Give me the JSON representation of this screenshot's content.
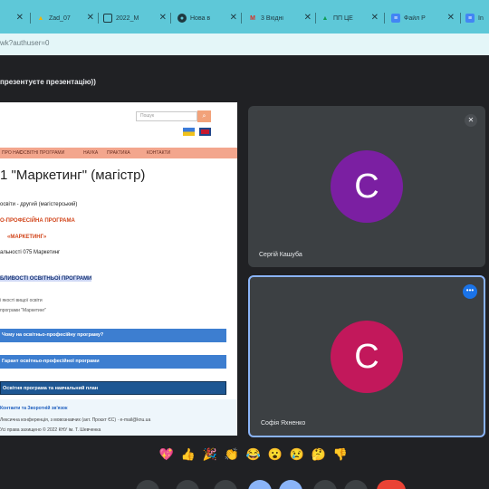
{
  "browser": {
    "tabs": [
      {
        "label": "",
        "icon": "tab-icon"
      },
      {
        "label": "Zad_07",
        "icon": "google-drive-icon"
      },
      {
        "label": "2022_M",
        "icon": "document-icon"
      },
      {
        "label": "Нова в",
        "icon": "globe-icon"
      },
      {
        "label": "3 Вхідні",
        "icon": "gmail-icon"
      },
      {
        "label": "ПП ЦЕ",
        "icon": "google-drive-icon"
      },
      {
        "label": "Файл Р",
        "icon": "google-docs-icon"
      },
      {
        "label": "In",
        "icon": "google-docs-icon"
      }
    ],
    "url": "wk?authuser=0"
  },
  "meet": {
    "presenting_text": "презентуєте презентацію))",
    "participants": [
      {
        "initial": "С",
        "name": "Сергій Кашуба",
        "color": "#7b1fa2"
      },
      {
        "initial": "С",
        "name": "Софія Яхненко",
        "color": "#c2185b"
      }
    ],
    "reactions": [
      "💖",
      "👍",
      "🎉",
      "👏",
      "😂",
      "😮",
      "😢",
      "🤔",
      "👎"
    ]
  },
  "slide": {
    "search_placeholder": "Пошук",
    "menu": [
      "ПРО НАС",
      "ОСВІТНІ ПРОГРАМИ",
      "НАУКА",
      "ПРАКТИКА",
      "КОНТАКТИ"
    ],
    "title": "1 \"Маркетинг\" (магістр)",
    "level": "освіти - другий (магістерський)",
    "program_type": "О-ПРОФЕСІЙНА ПРОГРАМА",
    "program_name": "«МАРКЕТИНГ»",
    "specialty": "альності 075 Маркетинг",
    "features_head": "БЛИВОСТІ ОСВІТНЬОЇ ПРОГРАМИ",
    "feature_1": "і якості вищої освіти",
    "feature_2": "програми \"Маркетинг\"",
    "band_1": "Чому на освітньо-професійну програму?",
    "band_2": "Гарант освітньо-професійної програми",
    "band_3": "Освітня програма та навчальний план",
    "contacts": "Контакти та Зворотній зв'язок",
    "footer_1": "Лексична конференція, з мовознавчих (акт. Проєкт ЄС)  ·  e-mail@knu.ua",
    "footer_2": "Усі права захищено © 2022 КНУ ім. Т. Шевченка"
  }
}
